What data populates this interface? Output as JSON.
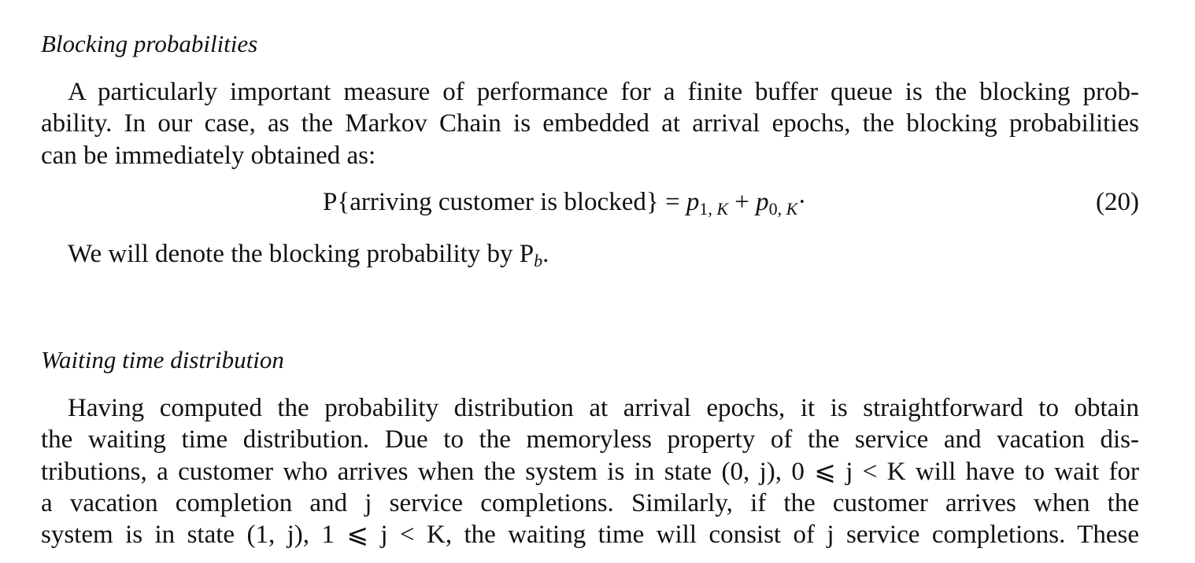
{
  "section1": {
    "heading": "Blocking probabilities",
    "para_lines": [
      "A particularly important measure of performance for a finite buffer queue is the blocking prob-",
      "ability. In our case, as the Markov Chain is embedded at arrival epochs, the blocking probabilities",
      "can be immediately obtained as:"
    ],
    "equation": {
      "lhs": "P{arriving customer is blocked}",
      "equals": "=",
      "term1_var": "p",
      "term1_sub_a": "1, ",
      "term1_sub_b": "K",
      "plus": "+",
      "term2_var": "p",
      "term2_sub_a": "0, ",
      "term2_sub_b": "K",
      "trail": "·",
      "number": "(20)"
    },
    "denote_text": "We will denote the blocking probability by P",
    "denote_sub": "b",
    "denote_end": "."
  },
  "section2": {
    "heading": "Waiting time distribution",
    "para_lines": [
      "Having computed the probability distribution at arrival epochs, it is straightforward to obtain",
      "the waiting time distribution. Due to the memoryless property of the service and vacation dis-",
      "tributions, a customer who arrives when the system is in state (0, j), 0 ⩽ j < K will have to wait for",
      "a vacation completion and j service completions. Similarly, if the customer arrives when the",
      "system is in state (1, j), 1 ⩽ j < K, the waiting time will consist of j service completions. These"
    ]
  }
}
